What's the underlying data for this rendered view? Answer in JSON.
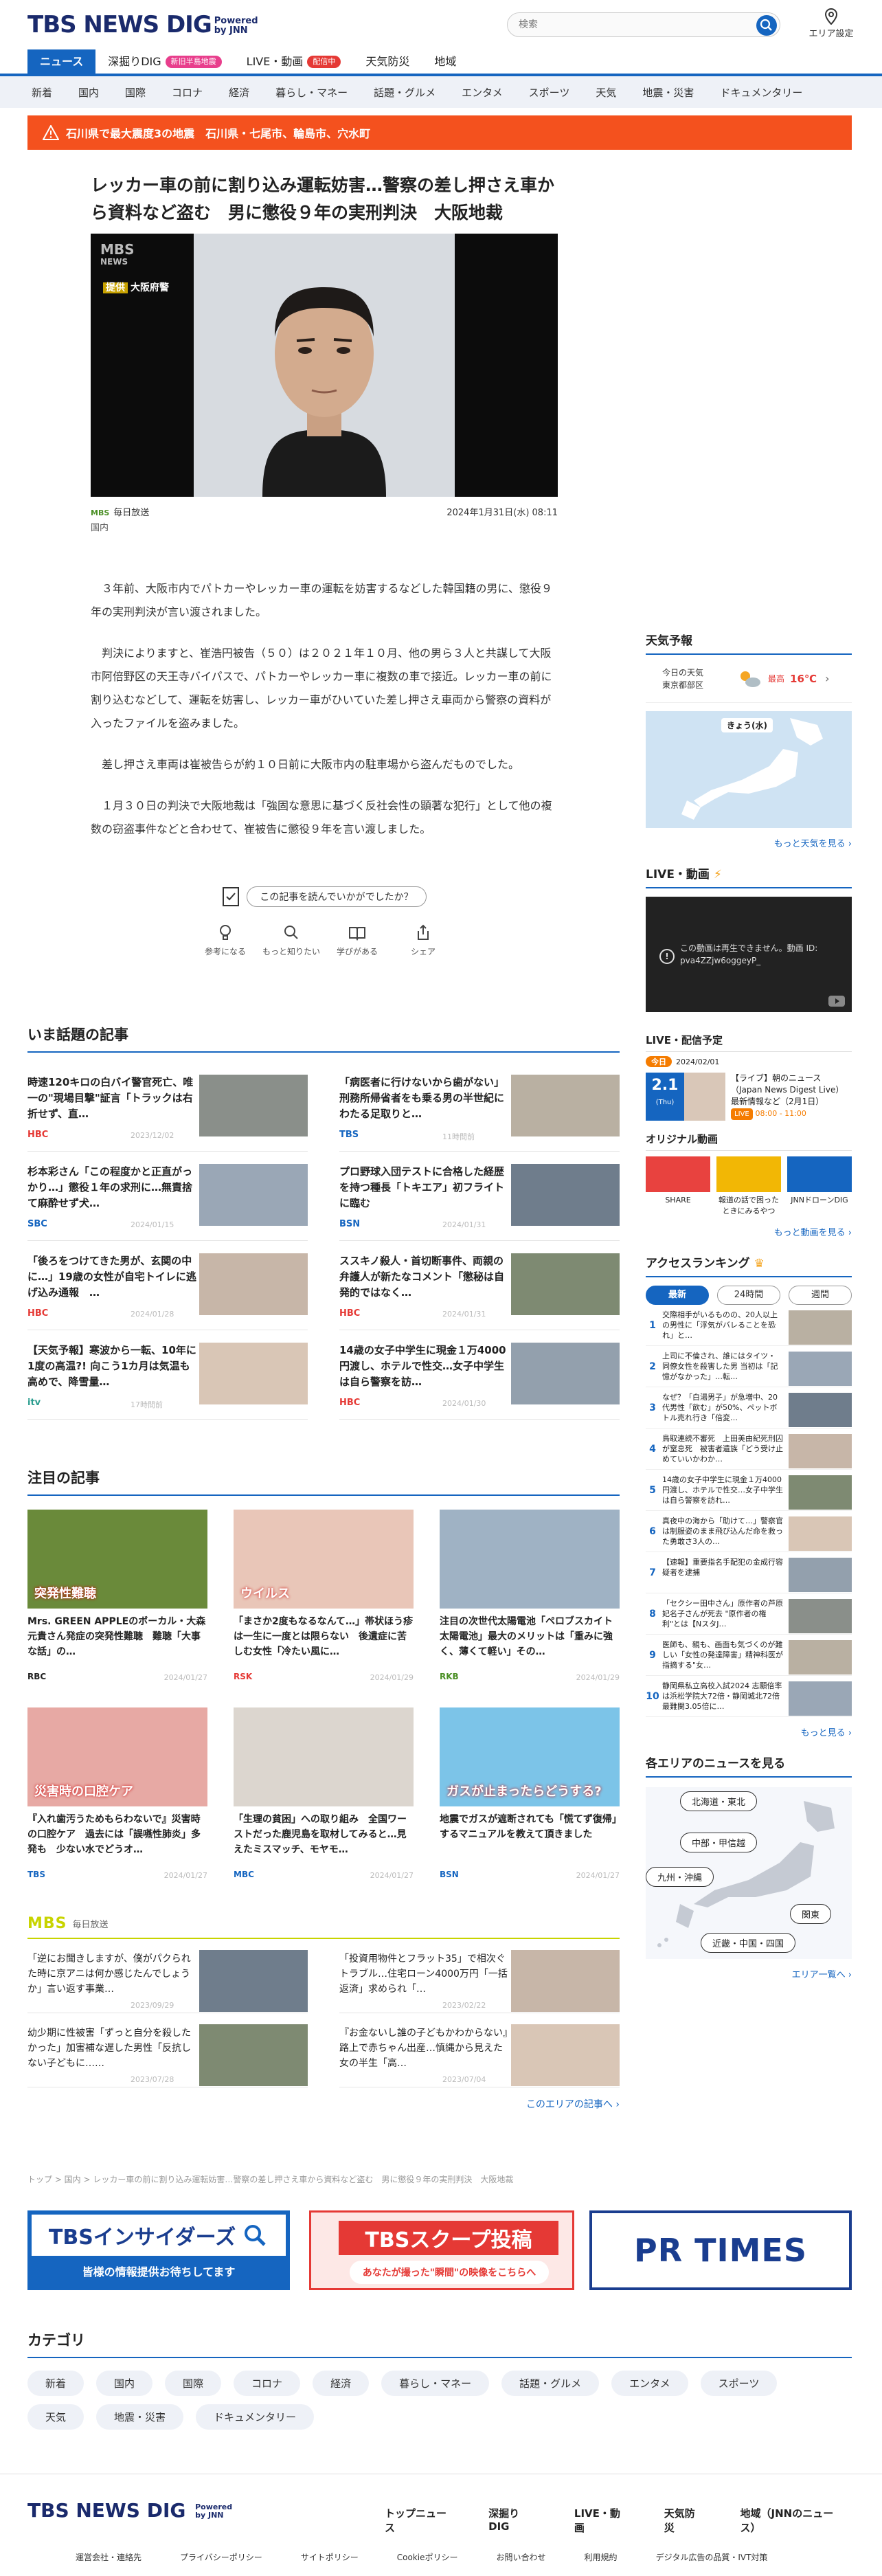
{
  "header": {
    "logo_text": "TBS NEWS DIG",
    "powered": "Powered by JNN",
    "search_placeholder": "検索",
    "area_label": "エリア設定",
    "nav": [
      {
        "label": "ニュース"
      },
      {
        "label": "深掘りDIG",
        "badge": "新旧半島地震"
      },
      {
        "label": "LIVE・動画",
        "badge": "配信中"
      },
      {
        "label": "天気防災"
      },
      {
        "label": "地域"
      }
    ],
    "subnav": [
      "新着",
      "国内",
      "国際",
      "コロナ",
      "経済",
      "暮らし・マネー",
      "話題・グルメ",
      "エンタメ",
      "スポーツ",
      "天気",
      "地震・災害",
      "ドキュメンタリー"
    ]
  },
  "alert": {
    "text": "石川県で最大震度3の地震　石川県・七尾市、輪島市、穴水町"
  },
  "article": {
    "title": "レッカー車の前に割り込み運転妨害…警察の差し押さえ車から資料など盗む　男に懲役９年の実刑判決　大阪地裁",
    "photo_logo": "MBS",
    "photo_logo_sub": "NEWS",
    "photo_caption_tag": "提供",
    "photo_caption": "大阪府警",
    "source_badge": "MBS",
    "source": "毎日放送",
    "date": "2024年1月31日(水) 08:11",
    "category": "国内",
    "paragraphs": [
      "３年前、大阪市内でパトカーやレッカー車の運転を妨害するなどした韓国籍の男に、懲役９年の実刑判決が言い渡されました。",
      "判決によりますと、崔浩円被告（５０）は２０２１年１０月、他の男ら３人と共謀して大阪市阿倍野区の天王寺バイパスで、パトカーやレッカー車に複数の車で接近。レッカー車の前に割り込むなどして、運転を妨害し、レッカー車がひいていた差し押さえ車両から警察の資料が入ったファイルを盗みました。",
      "差し押さえ車両は崔被告らが約１０日前に大阪市内の駐車場から盗んだものでした。",
      "１月３０日の判決で大阪地裁は「強固な意思に基づく反社会性の顕著な犯行」として他の複数の窃盗事件などと合わせて、崔被告に懲役９年を言い渡しました。"
    ],
    "feedback_question": "この記事を読んでいかがでしたか？",
    "feedback_actions": [
      "参考になる",
      "もっと知りたい",
      "学びがある",
      "シェア"
    ]
  },
  "trending": {
    "heading": "いま話題の記事",
    "items": [
      {
        "title": "時速120キロの白バイ警官死亡、唯一の\"現場目撃\"証言「トラックは右折せず、直…",
        "source": "HBC",
        "date": "2023/12/02",
        "color": "#e53935"
      },
      {
        "title": "「病医者に行けないから歯がない」刑務所帰省者をも乗る男の半世紀にわたる足取りと…",
        "source": "TBS",
        "date": "11時間前",
        "color": "#1565c0"
      },
      {
        "title": "杉本彩さん「この程度かと正直がっかり…」懲役１年の求刑に…無責捨て麻酔せず犬…",
        "source": "SBC",
        "date": "2024/01/15",
        "color": "#1565c0"
      },
      {
        "title": "プロ野球入団テストに合格した経歴を持つ種長「トキエア」初フライトに臨む",
        "source": "BSN",
        "date": "2024/01/31",
        "color": "#1565c0"
      },
      {
        "title": "「後ろをつけてきた男が、玄関の中に…」19歳の女性が自宅トイレに逃げ込み通報　…",
        "source": "HBC",
        "date": "2024/01/28",
        "color": "#e53935"
      },
      {
        "title": "ススキノ殺人・首切断事件、両親の弁護人が新たなコメント「懲秘は自発的ではなく…",
        "source": "HBC",
        "date": "2024/01/31",
        "color": "#e53935"
      },
      {
        "title": "【天気予報】寒波から一転、10年に1度の高温?! 向こう1カ月は気温も高めで、降雪量…",
        "source": "itv",
        "date": "17時間前",
        "color": "#2a9d8f"
      },
      {
        "title": "14歳の女子中学生に現金１万4000円渡し、ホテルで性交…女子中学生は自ら警察を訪…",
        "source": "HBC",
        "date": "2024/01/30",
        "color": "#e53935"
      }
    ]
  },
  "featured": {
    "heading": "注目の記事",
    "items": [
      {
        "title": "Mrs. GREEN APPLEのボーカル・大森元貴さん発症の突発性難聴　難聴「大事な話」の…",
        "source": "RBC",
        "date": "2024/01/27",
        "color": "#222",
        "thumb_text": "突発性難聴"
      },
      {
        "title": "「まさか2度もなるなんて…」帯状ほう疹は一生に一度とは限らない　後遺症に苦しむ女性「冷たい風に…",
        "source": "RSK",
        "date": "2024/01/29",
        "color": "#e53935",
        "thumb_text": "ウイルス"
      },
      {
        "title": "注目の次世代太陽電池「ペロブスカイト太陽電池」最大のメリットは「重みに強く、薄くて軽い」その…",
        "source": "RKB",
        "date": "2024/01/29",
        "color": "#4a8f24",
        "thumb_text": ""
      },
      {
        "title": "『入れ歯汚うためもらわないで』災害時の口腔ケア　過去には「誤嚥性肺炎」多発も　少ない水でどうオ…",
        "source": "TBS",
        "date": "2024/01/27",
        "color": "#1565c0",
        "thumb_text": "災害時の口腔ケア"
      },
      {
        "title": "「生理の貧困」への取り組み　全国ワーストだった鹿児島を取材してみると…見えたミスマッチ、モヤモ…",
        "source": "MBC",
        "date": "2024/01/27",
        "color": "#1565c0",
        "thumb_text": ""
      },
      {
        "title": "地震でガスが遮断されても「慌てず復帰」するマニュアルを教えて頂きました",
        "source": "BSN",
        "date": "2024/01/27",
        "color": "#1565c0",
        "thumb_text": "ガスが止まったらどうする?"
      }
    ]
  },
  "mbs": {
    "logo": "MBS",
    "label": "毎日放送",
    "items": [
      {
        "title": "「逆にお聞きしますが、僕がパクられた時に京アニは何か感じたんでしょうか」言い返す事業…",
        "date": "2023/09/29"
      },
      {
        "title": "「投資用物件とフラット35」で相次ぐトラブル…住宅ローン4000万円「一括返済」求められ「…",
        "date": "2023/02/22"
      },
      {
        "title": "幼少期に性被害「ずっと自分を殺したかった」加害補な遅した男性「反抗しない子どもに……",
        "date": "2023/07/28"
      },
      {
        "title": "『お金ないし誰の子どもかわからない』路上で赤ちゃん出産…慎縄から見えた女の半生「高…",
        "date": "2023/07/04"
      }
    ],
    "more": "このエリアの記事へ ›"
  },
  "breadcrumb": "トップ > 国内 > レッカー車の前に割り込み運転妨害…警察の差し押さえ車から資料など盗む　男に懲役９年の実刑判決　大阪地裁",
  "banners": {
    "insiders": "TBSインサイダーズ",
    "insiders_sub": "皆様の情報提供お待ちしてます",
    "scoop": "TBSスクープ投稿",
    "scoop_sub": "あなたが撮った\"瞬間\"の映像をこちらへ",
    "prtimes": "PR TIMES"
  },
  "categories": {
    "heading": "カテゴリ",
    "items": [
      "新着",
      "国内",
      "国際",
      "コロナ",
      "経済",
      "暮らし・マネー",
      "話題・グルメ",
      "エンタメ",
      "スポーツ",
      "天気",
      "地震・災害",
      "ドキュメンタリー"
    ]
  },
  "sidebar": {
    "weather": {
      "heading": "天気予報",
      "today": "今日の天気",
      "region": "東京都部区",
      "label": "最高",
      "temp": "16℃",
      "map_title": "きょう(水)",
      "more": "もっと天気を見る ›"
    },
    "live": {
      "heading": "LIVE・動画",
      "error": "この動画は再生できません。動画 ID: pva4ZZjw6oggeyP_"
    },
    "schedule": {
      "heading": "LIVE・配信予定",
      "today_badge": "今日",
      "date": "2024/02/01",
      "day": "2.1",
      "weekday": "(Thu)",
      "title": "【ライブ】朝のニュース（Japan News Digest Live）最新情報など（2月1日）",
      "live_badge": "LIVE",
      "time": "08:00 - 11:00"
    },
    "original": {
      "heading": "オリジナル動画",
      "items": [
        "SHARE",
        "報道の話で困ったときにみるやつ",
        "JNNドローンDIG"
      ],
      "more": "もっと動画を見る ›"
    },
    "ranking": {
      "heading": "アクセスランキング",
      "tabs": [
        "最新",
        "24時間",
        "週間"
      ],
      "items": [
        "交際相手がいるものの、20人以上の男性に「浮気がバレることを恐れ」と…",
        "上司に不倫され、誰にはタイツ・同僚女性を殺害した男 当初は「記憶がなかった」…転…",
        "なぜ？「白湯男子」が急増中、20代男性「飲む」が50%、ペットボトル売れ行き「倍変…",
        "鳥取連続不審死　上田美由紀死刑囚が窒息死　被害者遺族「どう受け止めていいかわか…",
        "14歳の女子中学生に現金１万4000円渡し、ホテルで性交…女子中学生は自ら警察を訪れ…",
        "真夜中の海から「助けて…」警察官は制服姿のまま飛び込んだ命を救った勇敢さ3人の…",
        "【速報】重要指名手配犯の金成行容疑者を逮捕",
        "「セクシー田中さん」原作者の芦原妃名子さんが死去 \"原作者の権利\"とは【NスタJ…",
        "医師も、親も、画面も気づくのが難しい「女性の発達障害」精神科医が指摘する\"女…",
        "静岡県私立高校入試2024 志願倍率は浜松学院大72倍・静岡城北72倍　最難関3.05倍に…"
      ],
      "more": "もっと見る ›"
    },
    "regions": {
      "heading": "各エリアのニュースを見る",
      "items": [
        "北海道・東北",
        "中部・甲信越",
        "九州・沖縄",
        "関東",
        "近畿・中国・四国"
      ],
      "more": "エリア一覧へ ›"
    }
  },
  "footer": {
    "logo": "TBS NEWS DIG",
    "nav": [
      "トップニュース",
      "深掘りDIG",
      "LIVE・動画",
      "天気防災",
      "地域（JNNのニュース）"
    ],
    "links": [
      "運営会社・連絡先",
      "プライバシーポリシー",
      "サイトポリシー",
      "Cookieポリシー",
      "お問い合わせ",
      "利用規約",
      "デジタル広告の品質・IVT対策"
    ]
  },
  "colors": {
    "brand": "#1565c0",
    "alert": "#f4511e",
    "mbs": "#c8d400"
  }
}
